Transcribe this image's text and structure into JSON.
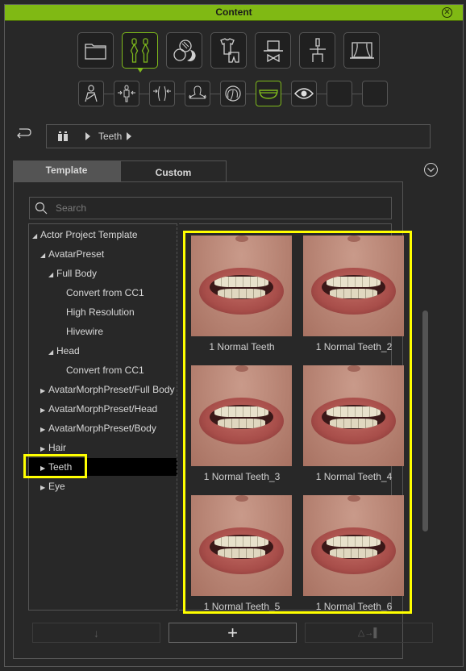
{
  "window": {
    "title": "Content",
    "close_icon": "circle-x-icon"
  },
  "colors": {
    "accent": "#80b914",
    "highlight": "#ffff00",
    "background": "#282828"
  },
  "categories": [
    {
      "name": "folder",
      "icon": "folder-icon",
      "active": false
    },
    {
      "name": "actor",
      "icon": "actor-pair-icon",
      "active": true
    },
    {
      "name": "material",
      "icon": "material-spheres-icon",
      "active": false
    },
    {
      "name": "cloth",
      "icon": "cloth-icon",
      "active": false
    },
    {
      "name": "accessory",
      "icon": "hat-bowtie-icon",
      "active": false
    },
    {
      "name": "motion",
      "icon": "figure-icon",
      "active": false
    },
    {
      "name": "stage",
      "icon": "stage-curtain-icon",
      "active": false
    }
  ],
  "subcategories": [
    {
      "name": "avatar",
      "icon": "avatar-icon",
      "active": false
    },
    {
      "name": "body-morph",
      "icon": "body-morph-icon",
      "active": false
    },
    {
      "name": "body-shape",
      "icon": "body-shape-icon",
      "active": false
    },
    {
      "name": "head-morph",
      "icon": "head-morph-icon",
      "active": false
    },
    {
      "name": "hair",
      "icon": "hair-icon",
      "active": false
    },
    {
      "name": "teeth",
      "icon": "teeth-icon",
      "active": true
    },
    {
      "name": "eye",
      "icon": "eye-icon",
      "active": false
    },
    {
      "name": "empty-1",
      "icon": "",
      "active": false
    },
    {
      "name": "empty-2",
      "icon": "",
      "active": false
    }
  ],
  "breadcrumb": {
    "root_icon": "actor-icon",
    "items": [
      "Teeth"
    ]
  },
  "tabs": [
    {
      "label": "Template",
      "active": true
    },
    {
      "label": "Custom",
      "active": false
    }
  ],
  "search": {
    "placeholder": "Search",
    "value": ""
  },
  "tree": [
    {
      "label": "Actor Project Template",
      "depth": 0,
      "arrow": "expanded",
      "selected": false
    },
    {
      "label": "AvatarPreset",
      "depth": 1,
      "arrow": "expanded",
      "selected": false
    },
    {
      "label": "Full Body",
      "depth": 2,
      "arrow": "expanded",
      "selected": false
    },
    {
      "label": "Convert from CC1",
      "depth": 3,
      "arrow": "none",
      "selected": false
    },
    {
      "label": "High Resolution",
      "depth": 3,
      "arrow": "none",
      "selected": false
    },
    {
      "label": "Hivewire",
      "depth": 3,
      "arrow": "none",
      "selected": false
    },
    {
      "label": "Head",
      "depth": 2,
      "arrow": "expanded",
      "selected": false
    },
    {
      "label": "Convert from CC1",
      "depth": 3,
      "arrow": "none",
      "selected": false
    },
    {
      "label": "AvatarMorphPreset/Full Body",
      "depth": 1,
      "arrow": "collapsed",
      "selected": false
    },
    {
      "label": "AvatarMorphPreset/Head",
      "depth": 1,
      "arrow": "collapsed",
      "selected": false
    },
    {
      "label": "AvatarMorphPreset/Body",
      "depth": 1,
      "arrow": "collapsed",
      "selected": false
    },
    {
      "label": "Hair",
      "depth": 1,
      "arrow": "collapsed",
      "selected": false
    },
    {
      "label": "Teeth",
      "depth": 1,
      "arrow": "collapsed",
      "selected": true
    },
    {
      "label": "Eye",
      "depth": 1,
      "arrow": "collapsed",
      "selected": false
    }
  ],
  "items": [
    {
      "label": "1 Normal Teeth"
    },
    {
      "label": "1 Normal Teeth_2"
    },
    {
      "label": "1 Normal Teeth_3"
    },
    {
      "label": "1 Normal Teeth_4"
    },
    {
      "label": "1 Normal Teeth_5"
    },
    {
      "label": "1 Normal Teeth_6"
    }
  ],
  "bottom_buttons": [
    {
      "name": "apply-down",
      "icon": "arrow-down-icon",
      "glyph": "↓",
      "enabled": false
    },
    {
      "name": "add",
      "icon": "plus-icon",
      "glyph": "+",
      "enabled": true
    },
    {
      "name": "replace",
      "icon": "replace-icon",
      "glyph": "△→▌",
      "enabled": false
    }
  ]
}
